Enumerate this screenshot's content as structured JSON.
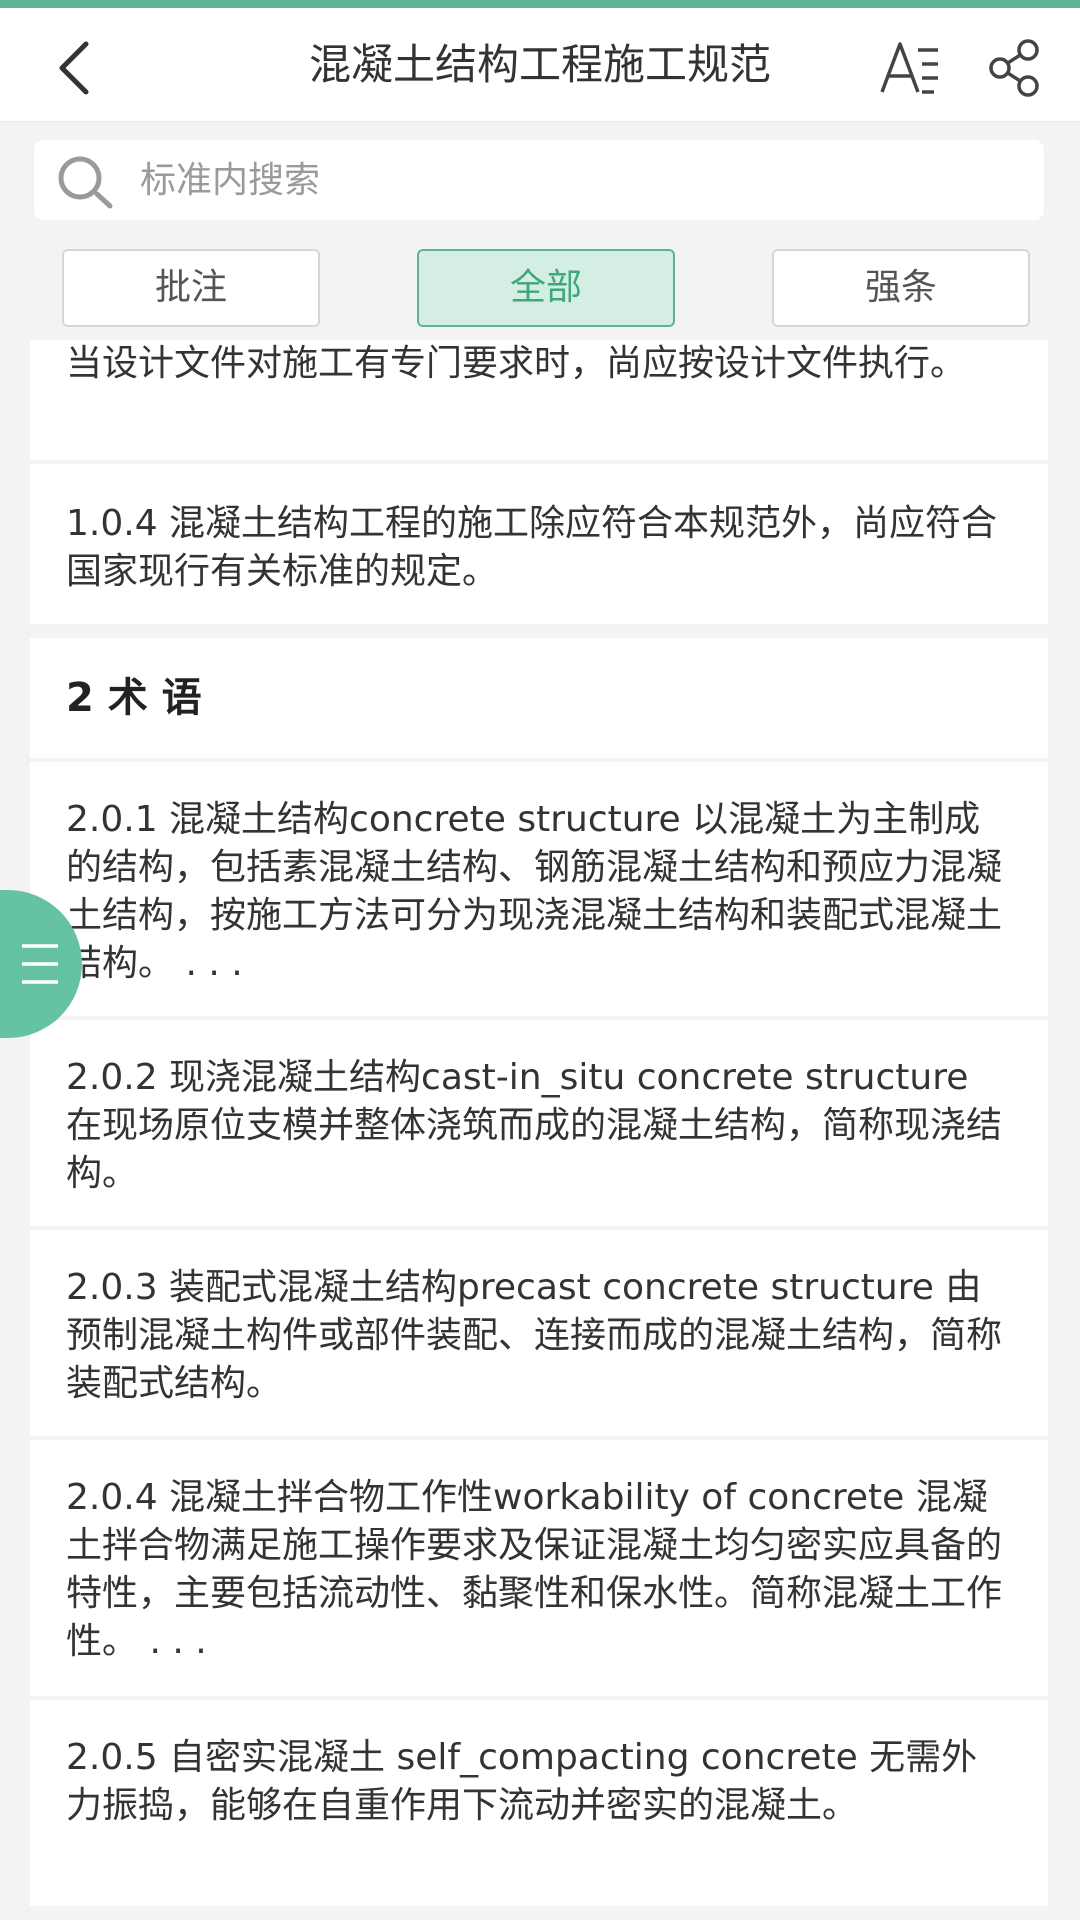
{
  "header": {
    "title": "混凝土结构工程施工规范"
  },
  "search": {
    "placeholder": "标准内搜索"
  },
  "tabs": [
    {
      "label": "批注"
    },
    {
      "label": "全部"
    },
    {
      "label": "强条"
    }
  ],
  "entries": [
    {
      "text": "当设计文件对施工有专门要求时，尚应按设计文件执行。"
    },
    {
      "text": "1.0.4 混凝土结构工程的施工除应符合本规范外，尚应符合国家现行有关标准的规定。"
    },
    {
      "text": "2 术 语"
    },
    {
      "text": "2.0.1 混凝土结构concrete structure 以混凝土为主制成的结构，包括素混凝土结构、钢筋混凝土结构和预应力混凝土结构，按施工方法可分为现浇混凝土结构和装配式混凝土结构。 . . ."
    },
    {
      "text": "2.0.2 现浇混凝土结构cast-in_situ concrete structure 在现场原位支模并整体浇筑而成的混凝土结构，简称现浇结构。"
    },
    {
      "text": "2.0.3 装配式混凝土结构precast concrete structure 由预制混凝土构件或部件装配、连接而成的混凝土结构，简称装配式结构。"
    },
    {
      "text": "2.0.4 混凝土拌合物工作性workability of concrete 混凝土拌合物满足施工操作要求及保证混凝土均匀密实应具备的特性，主要包括流动性、黏聚性和保水性。简称混凝土工作性。 . . ."
    },
    {
      "text": "2.0.5 自密实混凝土 self_compacting concrete 无需外力振捣，能够在自重作用下流动并密实的混凝土。"
    }
  ],
  "colors": {
    "accent": "#5bb596",
    "tab_active_bg": "#d5eee4",
    "side_handle": "#66c2a5"
  }
}
